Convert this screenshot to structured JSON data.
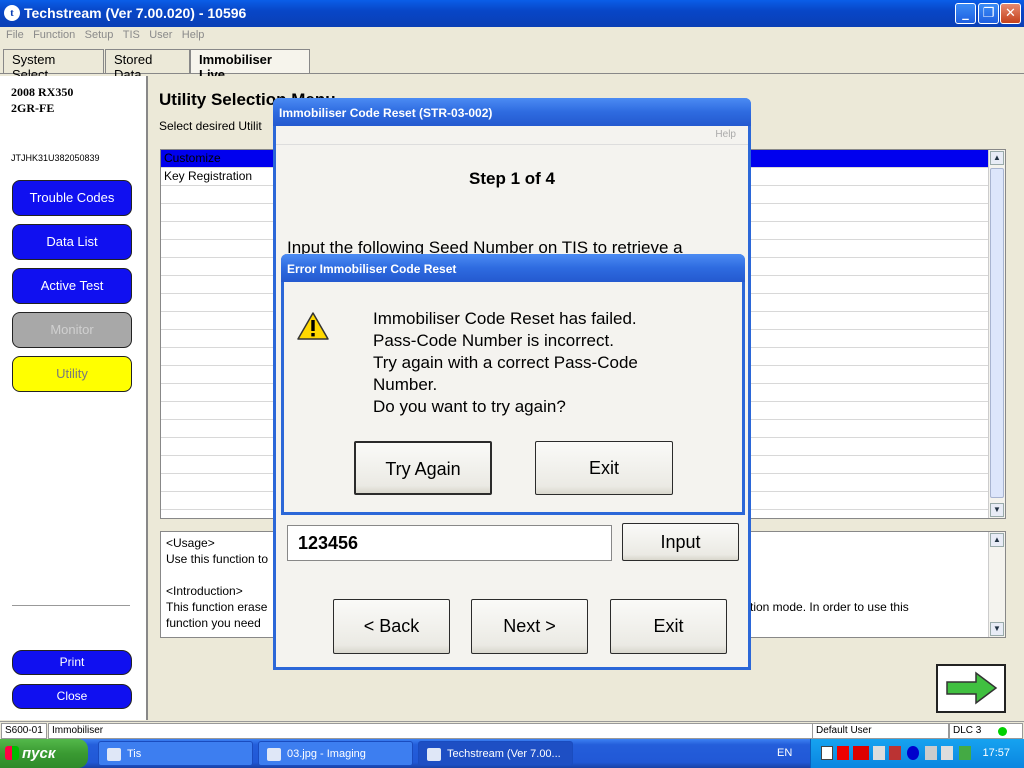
{
  "window": {
    "title": "Techstream (Ver 7.00.020) - 10596",
    "app_icon": "t",
    "minimize": "_",
    "maximize": "❐",
    "close": "✕"
  },
  "menu": [
    "File",
    "Function",
    "Setup",
    "TIS",
    "User",
    "Help"
  ],
  "tabs": [
    "System Select",
    "Stored Data",
    "Immobiliser Live"
  ],
  "vehicle": {
    "model": "2008 RX350",
    "engine": "2GR-FE",
    "vin": "JTJHK31U382050839"
  },
  "sidebar": {
    "buttons": [
      "Trouble Codes",
      "Data List",
      "Active Test",
      "Monitor",
      "Utility"
    ],
    "print": "Print",
    "close": "Close"
  },
  "main": {
    "title": "Utility Selection Menu",
    "subtitle": "Select desired Utilit",
    "list": [
      "Customize",
      "Key Registration"
    ],
    "usage_label": "<Usage>",
    "usage_text": "Use this function to",
    "intro_label": "<Introduction>",
    "intro_text": "This function erase",
    "intro_text_right": "tration mode. In order to use this",
    "intro_text2": "function you need"
  },
  "dialog_reset": {
    "title": "Immobiliser Code Reset (STR-03-002)",
    "help": "Help",
    "step": "Step 1 of 4",
    "instruction": "Input the following Seed Number on TIS to retrieve a",
    "code_value": "123456",
    "input_button": "Input",
    "back_button": "< Back",
    "next_button": "Next >",
    "exit_button": "Exit"
  },
  "dialog_error": {
    "title": "Error Immobiliser Code Reset",
    "line1": "Immobiliser Code Reset has failed.",
    "line2": "Pass-Code Number is incorrect.",
    "line3": "Try again with a correct Pass-Code",
    "line4": "Number.",
    "line5": "Do you want to try again?",
    "try_again_button": "Try Again",
    "exit_button": "Exit"
  },
  "statusbar": {
    "code": "S600-01",
    "module": "Immobiliser",
    "user": "Default User",
    "dlc": "DLC 3"
  },
  "taskbar": {
    "start": "пуск",
    "items": [
      "Tis",
      "03.jpg - Imaging",
      "Techstream (Ver 7.00..."
    ],
    "lang": "EN",
    "clock": "17:57"
  },
  "colors": {
    "titlebar": "#0846c7",
    "sidebar_button": "#1010f0",
    "utility_selected": "#ffff00",
    "monitor_disabled": "#a8a8a8",
    "list_selected": "#0000ee",
    "dlc_status": "#00d000"
  }
}
